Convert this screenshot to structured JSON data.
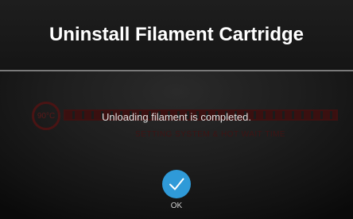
{
  "dialog": {
    "title": "Uninstall Filament Cartridge",
    "message": "Unloading filament is completed.",
    "ok_label": "OK"
  },
  "background_graphic": {
    "temperature_readout": "90°C",
    "status_caption": "SETTING SYSTEM & HOT WAIT TIME"
  },
  "icons": {
    "ok": "checkmark-icon"
  },
  "colors": {
    "header_background": "#1a1a1a",
    "divider": "#7a7a7a",
    "accent_blue": "#2f9ad8",
    "faded_red": "#3d1111"
  }
}
